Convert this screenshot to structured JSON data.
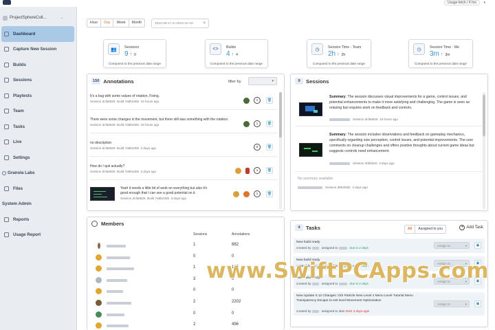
{
  "app": {
    "usage_label": "Usage fetch / 4 hrs"
  },
  "sidebar": {
    "project_name": "ProjectSphereColl...",
    "items": [
      {
        "label": "Dashboard",
        "active": true,
        "icon": "dashboard-icon"
      },
      {
        "label": "Capture New Session",
        "icon": "capture-icon"
      },
      {
        "label": "Builds",
        "icon": "builds-icon"
      },
      {
        "label": "Sessions",
        "icon": "sessions-icon"
      },
      {
        "label": "Playtests",
        "icon": "playtests-icon"
      },
      {
        "label": "Team",
        "icon": "team-icon"
      },
      {
        "label": "Tasks",
        "icon": "tasks-icon"
      },
      {
        "label": "Live",
        "icon": "live-icon"
      },
      {
        "label": "Settings",
        "icon": "settings-icon"
      }
    ],
    "section_granola": "Granola Labs",
    "files_label": "Files",
    "section_admin": "System Admin",
    "reports_label": "Reports",
    "usage_report_label": "Usage Report"
  },
  "filters": {
    "ranges": [
      "Hour",
      "Day",
      "Week",
      "Month"
    ],
    "selected": "Day",
    "date_range": "2024-08-17 to 2024-10-18"
  },
  "stats": [
    {
      "title": "Sessions",
      "value": "9",
      "delta": "0",
      "compare": "Compared to the previous date range",
      "icon": "users-icon"
    },
    {
      "title": "Builds",
      "value": "4",
      "delta": "4",
      "compare": "Compared to the previous date range",
      "icon": "code-icon"
    },
    {
      "title": "Session Time - Team",
      "value": "2h",
      "delta": "2h",
      "compare": "Compared to the previous date range",
      "icon": "clock-icon"
    },
    {
      "title": "Session Time - Me",
      "value": "3m",
      "delta": "3m",
      "compare": "Compared to the previous date range",
      "icon": "clock-icon"
    }
  ],
  "annotations": {
    "count": "150",
    "title": "Annotations",
    "filter_label": "filter by",
    "rows": [
      {
        "text": "It's a bug with some values of rotation, Fixing.",
        "session": "Session dcfa6828",
        "build": "Build 7a8b4305",
        "time": "16 hours ago",
        "comments": "1"
      },
      {
        "text": "There were some changes in the movement, but there still was something with the rotation.",
        "session": "Session dcfa6828",
        "build": "Build 7a8b4305",
        "time": "16 hours ago",
        "comments": "1"
      },
      {
        "text": "no description",
        "session": "Session dcfa6828",
        "build": "Build 7a8b4305",
        "time": "2 days ago",
        "comments": "0"
      },
      {
        "text": "How do I quit actually?",
        "session": "Session dcfa6828",
        "build": "Build 7a8b4305",
        "time": "3 days ago",
        "comments": "1"
      },
      {
        "text": "Yeah it needs a little bit of work on everything but also it's good enough that I can see a good potential on it.",
        "session": "Session dcfa6828",
        "build": "Build 7a8b4305",
        "time": "3 days ago",
        "comments": "1"
      }
    ]
  },
  "sessions": {
    "count": "9",
    "title": "Sessions",
    "summary_label": "Summary",
    "rows": [
      {
        "summary": ": The session discusses visual improvements for a game, control issues, and potential enhancements to make it more satisfying and challenging. The game is seen as relaxing but requires work on feedback and controls.",
        "session": "Session dcfa6828",
        "time": "16 hours ago"
      },
      {
        "summary": ": The session includes observations and feedback on gameplay mechanics, specifically regarding size perception, control issues, and potential improvements. The user comments on cleanup challenges and offers positive thoughts about current game ideas but suggests controls need enhancement.",
        "session": "Session 30b00e5",
        "time": "3 days ago"
      },
      {
        "summary": "No summary available",
        "session": "Session d8b4fdd2",
        "time": "4 days ago"
      }
    ]
  },
  "members": {
    "title": "Members",
    "col_sessions": "Sessions",
    "col_annotations": "Annotations",
    "rows": [
      {
        "sessions": "1",
        "annotations": "882",
        "color": "#8a6a4a"
      },
      {
        "sessions": "0",
        "annotations": "0",
        "color": "#e0a62e"
      },
      {
        "sessions": "1",
        "annotations": "135",
        "color": "#e0a62e"
      },
      {
        "sessions": "3",
        "annotations": "0",
        "color": "#b0b6c0"
      },
      {
        "sessions": "0",
        "annotations": "0",
        "color": "#e0a62e"
      },
      {
        "sessions": "2",
        "annotations": "2202",
        "color": "#7a5a3a"
      },
      {
        "sessions": "0",
        "annotations": "0",
        "color": "#4a8a5a"
      },
      {
        "sessions": "2",
        "annotations": "496",
        "color": "#e0a62e"
      }
    ]
  },
  "tasks": {
    "count": "4",
    "title": "Tasks",
    "filter_all": "All",
    "filter_assigned": "Assigned to you",
    "add_label": "Add Task",
    "assign_placeholder": "Assign to",
    "rows": [
      {
        "title": "New build ready",
        "created": "created by",
        "assigned": "assigned to",
        "due": "due in 2 days",
        "overdue": false
      },
      {
        "title": "New build ready",
        "created": "created by",
        "assigned": "assigned to",
        "due": "due in 2 days",
        "overdue": false
      },
      {
        "title": "New build ready",
        "created": "created by",
        "assigned": "assigned to",
        "due": "due in 2 days",
        "overdue": false
      },
      {
        "title": "New Update 0.12 Changes: Orb Particle New Level 4 Menu Level Tutorial Menu Transparency Escape to exit level Movement Optimization",
        "created": "created by",
        "assigned": "assigned to Idan",
        "due": "DUE 3 days ago!",
        "overdue": true
      }
    ]
  },
  "watermark": "www.SwiftPCApps.com"
}
